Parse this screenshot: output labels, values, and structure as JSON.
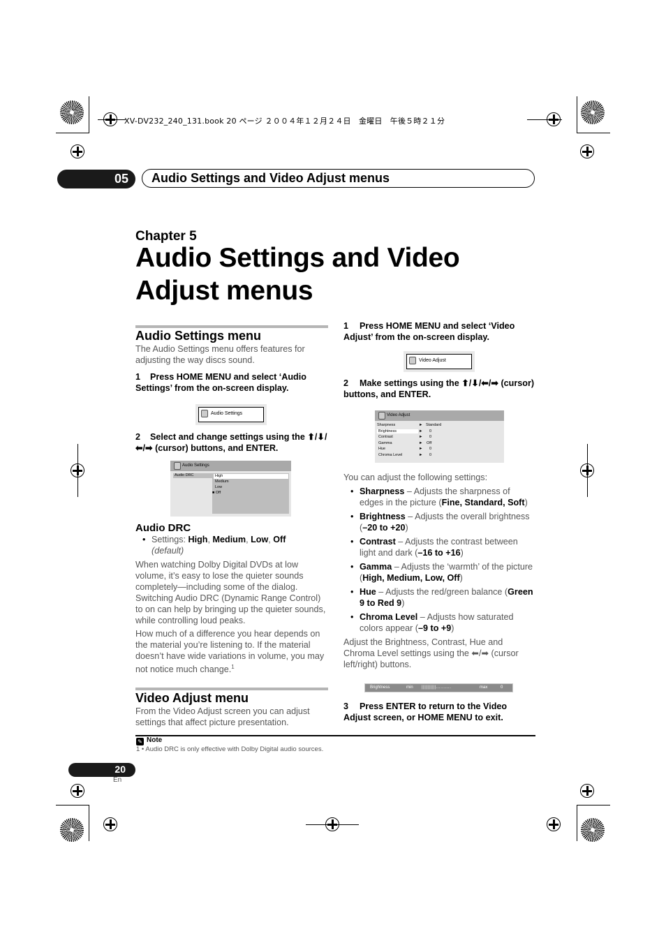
{
  "print_meta": {
    "book_line": "XV-DV232_240_131.book  20 ページ  ２００４年１２月２４日　金曜日　午後５時２１分"
  },
  "header": {
    "chapter_number": "05",
    "title": "Audio Settings and Video Adjust menus"
  },
  "chapter": {
    "label": "Chapter 5",
    "title": "Audio Settings and Video Adjust menus"
  },
  "audio_section": {
    "title": "Audio Settings menu",
    "intro": "The Audio Settings menu offers features for adjusting the way discs sound.",
    "step1_num": "1",
    "step1": "Press HOME MENU and select ‘Audio Settings’ from the on-screen display.",
    "osd_button": {
      "icon": "speaker-icon",
      "label": "Audio Settings"
    },
    "step2_num": "2",
    "step2": "Select and change settings using the ⬆/⬇/⬅/➡ (cursor) buttons, and ENTER.",
    "osd_panel": {
      "title": "Audio Settings",
      "item": "Audio DRC",
      "options": [
        "High",
        "Medium",
        "Low",
        "Off"
      ],
      "highlighted": "High",
      "selected_marker": "■",
      "current": "Off"
    },
    "drc": {
      "title": "Audio DRC",
      "settings_label": "Settings:",
      "settings": [
        "High",
        "Medium",
        "Low",
        "Off"
      ],
      "default_note": "(default)",
      "para1": "When watching Dolby Digital DVDs at low volume, it’s easy to lose the quieter sounds completely—including some of the dialog. Switching Audio DRC (Dynamic Range Control) to on can help by bringing up the quieter sounds, while controlling loud peaks.",
      "para2": "How much of a difference you hear depends on the material you’re listening to. If the material doesn’t have wide variations in volume, you may not notice much change.",
      "footnote_ref": "1"
    }
  },
  "video_section": {
    "title": "Video Adjust menu",
    "intro": "From the Video Adjust screen you can adjust settings that affect picture presentation.",
    "step1_num": "1",
    "step1": "Press HOME MENU and select ‘Video Adjust’ from the on-screen display.",
    "osd_button": {
      "icon": "monitor-icon",
      "label": "Video Adjust"
    },
    "step2_num": "2",
    "step2": "Make settings using the ⬆/⬇/⬅/➡ (cursor) buttons, and ENTER.",
    "osd_panel": {
      "title": "Video Adjust",
      "arrow": "►",
      "rows": [
        {
          "name": "Sharpness",
          "value": "Standard"
        },
        {
          "name": "Brightness",
          "value": "0"
        },
        {
          "name": "Contrast",
          "value": "0"
        },
        {
          "name": "Gamma",
          "value": "Off"
        },
        {
          "name": "Hue",
          "value": "0"
        },
        {
          "name": "Chroma Level",
          "value": "0"
        }
      ],
      "highlighted": "Brightness"
    },
    "list_intro": "You can adjust the following settings:",
    "settings": [
      {
        "name": "Sharpness",
        "desc": " – Adjusts the sharpness of edges in the picture (",
        "range": "Fine, Standard, Soft",
        "end": ")"
      },
      {
        "name": "Brightness",
        "desc": " – Adjusts the overall brightness (",
        "range": "–20 to +20",
        "end": ")"
      },
      {
        "name": "Contrast",
        "desc": " – Adjusts the contrast between light and dark (",
        "range": "–16 to +16",
        "end": ")"
      },
      {
        "name": "Gamma",
        "desc": " – Adjusts the ‘warmth’ of the picture (",
        "range": "High, Medium, Low, Off",
        "end": ")"
      },
      {
        "name": "Hue",
        "desc": " – Adjusts the red/green balance (",
        "range": "Green 9 to Red 9",
        "end": ")"
      },
      {
        "name": "Chroma Level",
        "desc": " – Adjusts how saturated colors appear (",
        "range": "–9 to +9",
        "end": ")"
      }
    ],
    "adjust_note": "Adjust the Brightness, Contrast, Hue and Chroma Level settings using the ⬅/➡ (cursor left/right) buttons.",
    "slider": {
      "label": "Brightness",
      "min_label": "min",
      "max_label": "max",
      "value": "0",
      "level_fraction": 0.5
    },
    "step3_num": "3",
    "step3": "Press ENTER to return to the Video Adjust screen, or HOME MENU to exit."
  },
  "note": {
    "title": "Note",
    "text": "1  • Audio DRC is only effective with Dolby Digital audio sources."
  },
  "footer": {
    "page_number": "20",
    "language": "En"
  }
}
